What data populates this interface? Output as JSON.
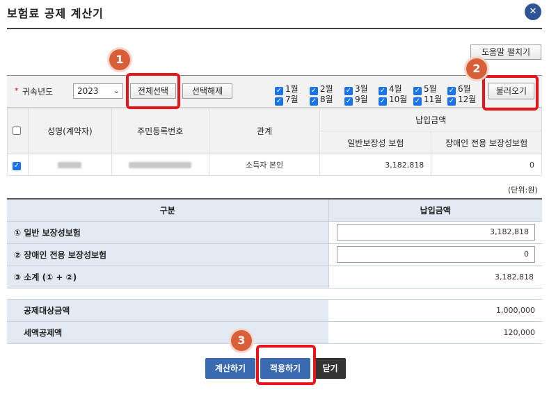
{
  "dialog": {
    "title": "보험료 공제 계산기",
    "close_icon": "close-icon"
  },
  "help_button": "도움말 펼치기",
  "filter": {
    "year_label": "귀속년도",
    "year_value": "2023",
    "select_all": "전체선택",
    "deselect": "선택해제",
    "load": "불러오기",
    "months": [
      "1월",
      "2월",
      "3월",
      "4월",
      "5월",
      "6월",
      "7월",
      "8월",
      "9월",
      "10월",
      "11월",
      "12월"
    ]
  },
  "table1": {
    "headers": {
      "name": "성명(계약자)",
      "rrn": "주민등록번호",
      "relation": "관계",
      "paid": "납입금액",
      "general": "일반보장성 보험",
      "disabled": "장애인 전용 보장성보험"
    },
    "rows": [
      {
        "relation": "소득자 본인",
        "general": "3,182,818",
        "disabled": "0",
        "checked": true
      }
    ]
  },
  "unit": "(단위:원)",
  "table2": {
    "header_cat": "구분",
    "header_amt": "납입금액",
    "row1_label": "① 일반 보장성보험",
    "row1_value": "3,182,818",
    "row2_label": "② 장애인 전용 보장성보험",
    "row2_value": "0",
    "row3_label": "③ 소계 (① + ②)",
    "row3_value": "3,182,818"
  },
  "table3": {
    "row1_label": "공제대상금액",
    "row1_value": "1,000,000",
    "row2_label": "세액공제액",
    "row2_value": "120,000"
  },
  "actions": {
    "calc": "계산하기",
    "apply": "적용하기",
    "close": "닫기"
  },
  "annotations": [
    "1",
    "2",
    "3"
  ],
  "colors": {
    "accent": "#2f5496",
    "highlight": "#e8141b",
    "badge": "#d95f39"
  }
}
